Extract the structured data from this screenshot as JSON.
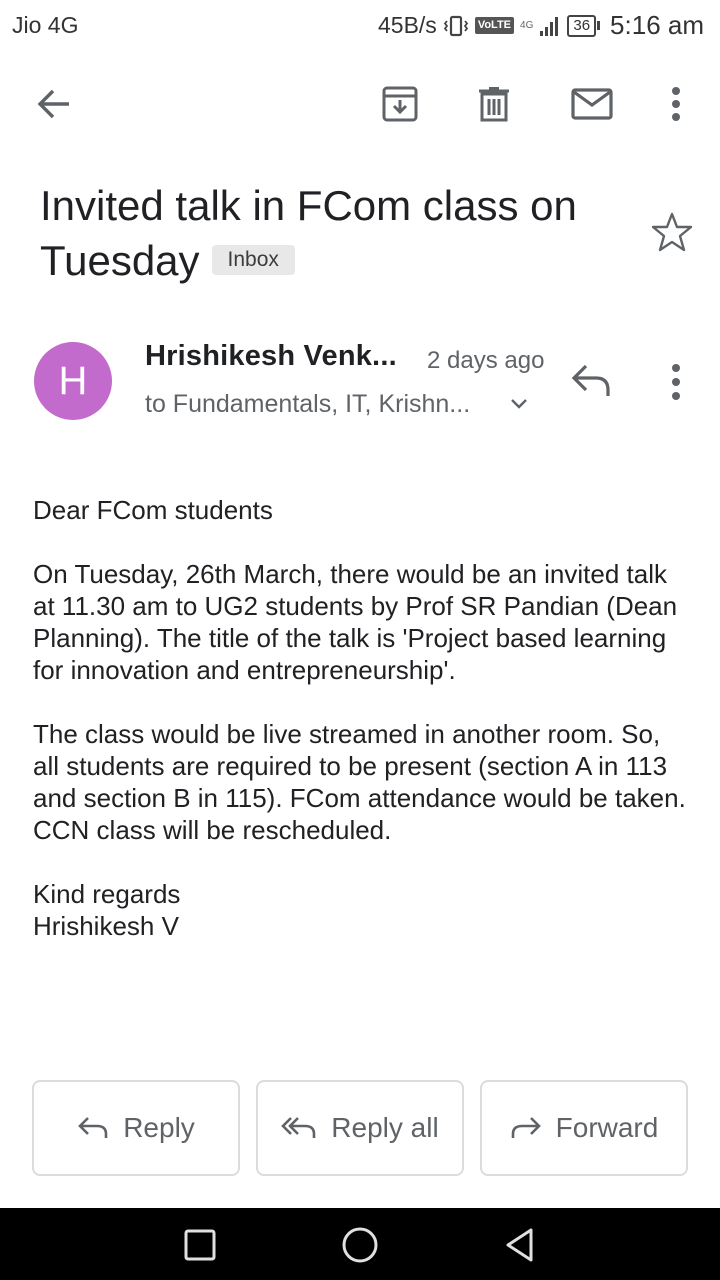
{
  "status_bar": {
    "carrier": "Jio 4G",
    "speed": "45B/s",
    "volte": "VoLTE",
    "network": "4G",
    "battery": "36",
    "time": "5:16 am"
  },
  "toolbar": {
    "back_icon": "arrow-left-icon",
    "archive_icon": "archive-icon",
    "delete_icon": "trash-icon",
    "mark_unread_icon": "mail-icon",
    "more_icon": "more-vertical-icon"
  },
  "email": {
    "subject": "Invited talk in FCom class on Tuesday",
    "label": "Inbox",
    "sender_initial": "H",
    "sender": "Hrishikesh Venk...",
    "time_ago": "2 days ago",
    "recipients": "to Fundamentals, IT, Krishn...",
    "avatar_color": "#c36bcc",
    "body": {
      "greeting": "Dear FCom students",
      "paragraph1": "On Tuesday, 26th March, there would be an invited talk at 11.30 am to UG2 students by Prof SR Pandian (Dean Planning). The title of the talk is 'Project based learning for innovation and entrepreneurship'.",
      "paragraph2": "The class would be live streamed in another room. So, all students are required to be present (section A in 113 and section B in 115). FCom attendance would be taken. CCN class will be rescheduled.",
      "signoff": "Kind regards",
      "signature": "Hrishikesh V"
    }
  },
  "actions": {
    "reply": "Reply",
    "reply_all": "Reply all",
    "forward": "Forward"
  }
}
